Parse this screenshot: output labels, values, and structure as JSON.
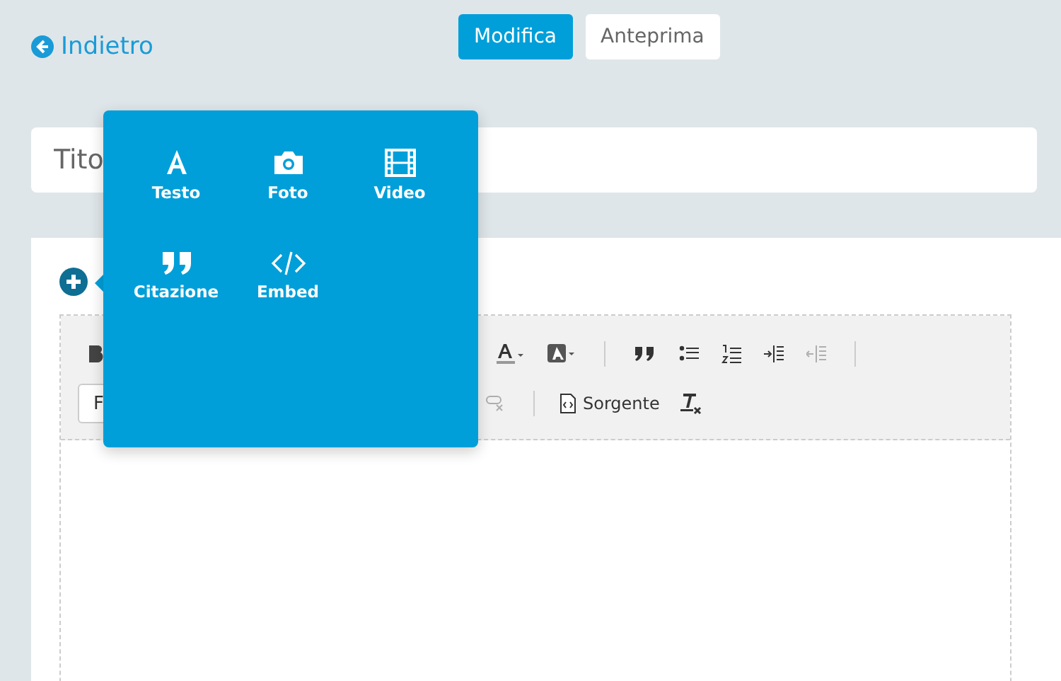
{
  "back_link": "Indietro",
  "mode_tabs": [
    {
      "label": "Modifica",
      "selected": true
    },
    {
      "label": "Anteprima",
      "selected": false
    }
  ],
  "title_field": {
    "placeholder": "Tito"
  },
  "insert_menu": {
    "open": true,
    "items": [
      {
        "kind": "text",
        "label": "Testo"
      },
      {
        "kind": "photo",
        "label": "Foto"
      },
      {
        "kind": "video",
        "label": "Video"
      },
      {
        "kind": "quote",
        "label": "Citazione"
      },
      {
        "kind": "embed",
        "label": "Embed"
      }
    ]
  },
  "toolbar": {
    "format_select": "F",
    "source_button": "Sorgente",
    "outdent_disabled": true,
    "unlink_disabled": true
  }
}
